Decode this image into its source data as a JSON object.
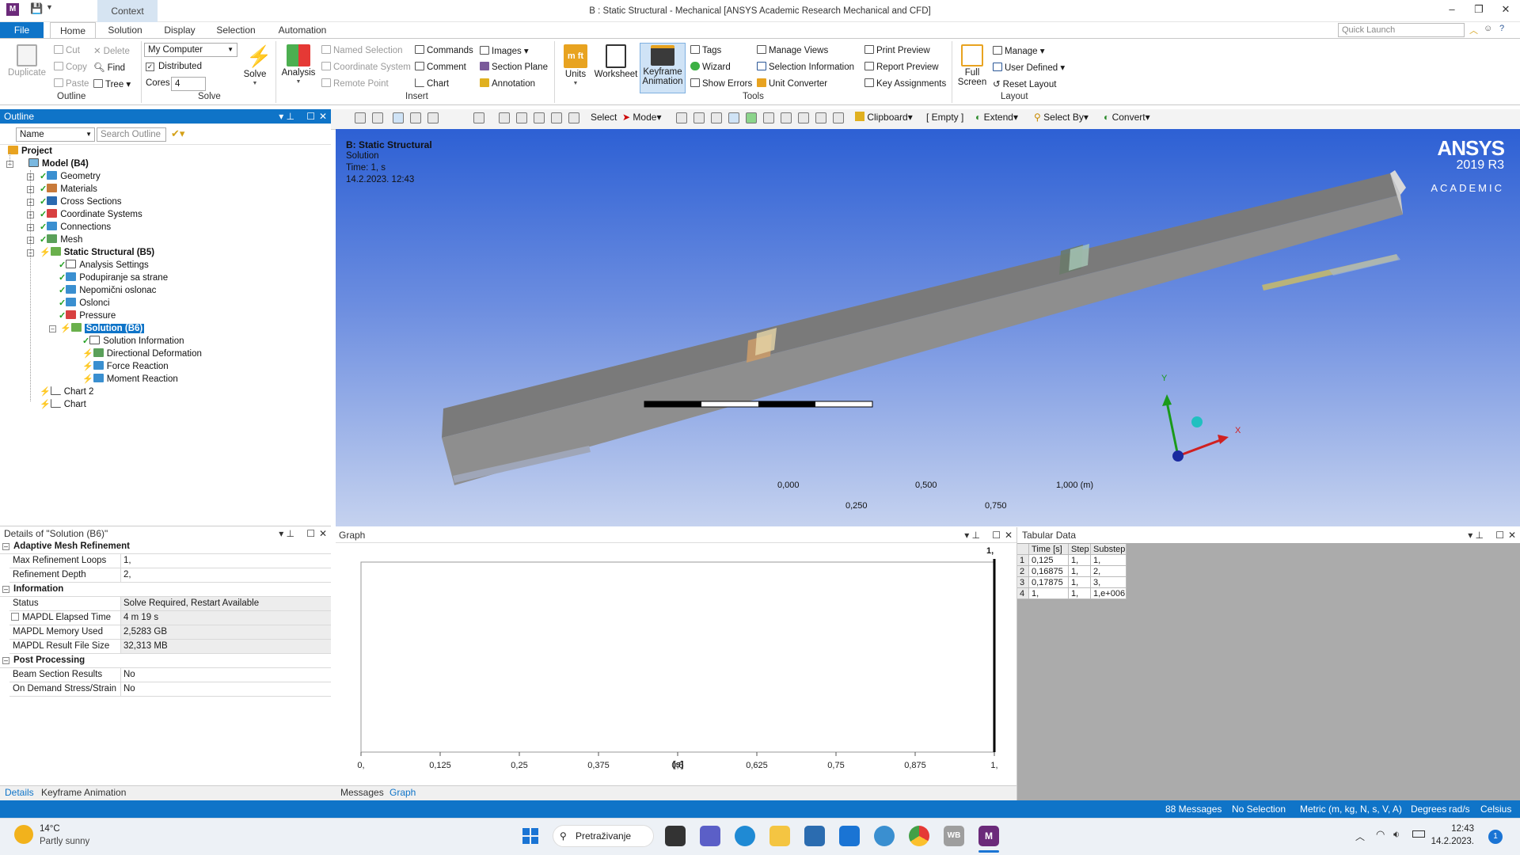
{
  "title_bar": {
    "app_letter": "M",
    "context_tab": "Context",
    "window_title": "B : Static Structural - Mechanical [ANSYS Academic Research Mechanical and CFD]",
    "minimize": "–",
    "restore": "❐",
    "close": "✕"
  },
  "ribbon_tabs": [
    "File",
    "Home",
    "Solution",
    "Display",
    "Selection",
    "Automation"
  ],
  "quick_launch": {
    "placeholder": "Quick Launch"
  },
  "ribbon": {
    "outline": {
      "label": "Outline",
      "duplicate": "Duplicate",
      "cut": "Cut",
      "copy": "Copy",
      "paste": "Paste",
      "delete": "Delete",
      "find": "Find",
      "tree": "Tree"
    },
    "solve": {
      "label": "Solve",
      "computer": "My Computer",
      "distributed": "Distributed",
      "distributed_checked": true,
      "cores_label": "Cores",
      "cores_value": "4",
      "solve_button": "Solve"
    },
    "insert": {
      "label": "Insert",
      "analysis": "Analysis",
      "named_selection": "Named Selection",
      "coordinate_system": "Coordinate System",
      "remote_point": "Remote Point",
      "commands": "Commands",
      "comment": "Comment",
      "chart": "Chart",
      "images": "Images",
      "section_plane": "Section Plane",
      "annotation": "Annotation"
    },
    "tools": {
      "label": "Tools",
      "units": "Units",
      "worksheet": "Worksheet",
      "keyframe_1": "Keyframe",
      "keyframe_2": "Animation",
      "tags": "Tags",
      "wizard": "Wizard",
      "show_errors": "Show Errors",
      "manage_views": "Manage Views",
      "selection_information": "Selection Information",
      "unit_converter": "Unit Converter",
      "print_preview": "Print Preview",
      "report_preview": "Report Preview",
      "key_assignments": "Key Assignments"
    },
    "layout": {
      "label": "Layout",
      "full_1": "Full",
      "full_2": "Screen",
      "manage": "Manage",
      "user_defined": "User Defined",
      "reset_layout": "Reset Layout"
    }
  },
  "toolbar": {
    "select": "Select",
    "mode": "Mode",
    "clipboard": "Clipboard",
    "empty": "[ Empty ]",
    "extend": "Extend",
    "select_by": "Select By",
    "convert": "Convert"
  },
  "outline_panel": {
    "title": "Outline",
    "name_combo": "Name",
    "search_placeholder": "Search Outline",
    "tree": [
      {
        "label": "Project",
        "depth": 0,
        "bold": true
      },
      {
        "label": "Model (B4)",
        "depth": 1,
        "bold": true
      },
      {
        "label": "Geometry",
        "depth": 2
      },
      {
        "label": "Materials",
        "depth": 2
      },
      {
        "label": "Cross Sections",
        "depth": 2
      },
      {
        "label": "Coordinate Systems",
        "depth": 2
      },
      {
        "label": "Connections",
        "depth": 2
      },
      {
        "label": "Mesh",
        "depth": 2
      },
      {
        "label": "Static Structural (B5)",
        "depth": 2,
        "bold": true
      },
      {
        "label": "Analysis Settings",
        "depth": 3
      },
      {
        "label": "Podupiranje sa strane",
        "depth": 3
      },
      {
        "label": "Nepomični oslonac",
        "depth": 3
      },
      {
        "label": "Oslonci",
        "depth": 3
      },
      {
        "label": "Pressure",
        "depth": 3
      },
      {
        "label": "Solution (B6)",
        "depth": 3,
        "bold": true,
        "selected": true
      },
      {
        "label": "Solution Information",
        "depth": 4
      },
      {
        "label": "Directional Deformation",
        "depth": 4
      },
      {
        "label": "Force Reaction",
        "depth": 4
      },
      {
        "label": "Moment Reaction",
        "depth": 4
      },
      {
        "label": "Chart 2",
        "depth": 1
      },
      {
        "label": "Chart",
        "depth": 1
      }
    ]
  },
  "details_panel": {
    "title": "Details of \"Solution (B6)\"",
    "sections": [
      {
        "name": "Adaptive Mesh Refinement",
        "rows": [
          {
            "k": "Max Refinement Loops",
            "v": "1,"
          },
          {
            "k": "Refinement Depth",
            "v": "2,"
          }
        ]
      },
      {
        "name": "Information",
        "rows": [
          {
            "k": "Status",
            "v": "Solve Required, Restart Available"
          },
          {
            "k": "MAPDL Elapsed Time",
            "v": "4 m 19 s"
          },
          {
            "k": "MAPDL Memory Used",
            "v": "2,5283 GB"
          },
          {
            "k": "MAPDL Result File Size",
            "v": "32,313 MB"
          }
        ]
      },
      {
        "name": "Post Processing",
        "rows": [
          {
            "k": "Beam Section Results",
            "v": "No"
          },
          {
            "k": "On Demand Stress/Strain",
            "v": "No"
          }
        ]
      }
    ],
    "bottom_tabs": [
      "Details",
      "Keyframe Animation"
    ]
  },
  "viewport": {
    "analysis": "B: Static Structural",
    "type": "Solution",
    "time": "Time: 1, s",
    "date": "14.2.2023. 12:43",
    "logo_main": "ANSYS",
    "logo_version": "2019 R3",
    "logo_edition": "ACADEMIC",
    "scale_top": [
      "0,000",
      "0,500",
      "1,000 (m)"
    ],
    "scale_bottom": [
      "0,250",
      "0,750"
    ],
    "axis_y": "Y",
    "axis_x": "X"
  },
  "graph_panel": {
    "title": "Graph",
    "marker_label": "1,",
    "x_ticks": [
      "0,",
      "0,125",
      "0,25",
      "0,375",
      "0,5",
      "0,625",
      "0,75",
      "0,875",
      "1,"
    ],
    "x_unit": "[s]",
    "bottom_tabs": [
      "Messages",
      "Graph"
    ]
  },
  "tabular_panel": {
    "title": "Tabular Data",
    "columns": [
      "Time [s]",
      "Step",
      "Substep"
    ],
    "rows": [
      [
        "1",
        "0,125",
        "1,",
        "1,"
      ],
      [
        "2",
        "0,16875",
        "1,",
        "2,"
      ],
      [
        "3",
        "0,17875",
        "1,",
        "3,"
      ],
      [
        "4",
        "1,",
        "1,",
        "1,e+006"
      ]
    ]
  },
  "status_bar": {
    "messages": "88 Messages",
    "selection": "No Selection",
    "units": "Metric (m, kg, N, s, V, A)",
    "degrees": "Degrees",
    "rads": "rad/s",
    "temp": "Celsius"
  },
  "taskbar": {
    "weather_temp": "14°C",
    "weather_desc": "Partly sunny",
    "search": "Pretraživanje",
    "time": "12:43",
    "date": "14.2.2023.",
    "notification_count": "1",
    "wb_label": "WB",
    "m_label": "M"
  }
}
